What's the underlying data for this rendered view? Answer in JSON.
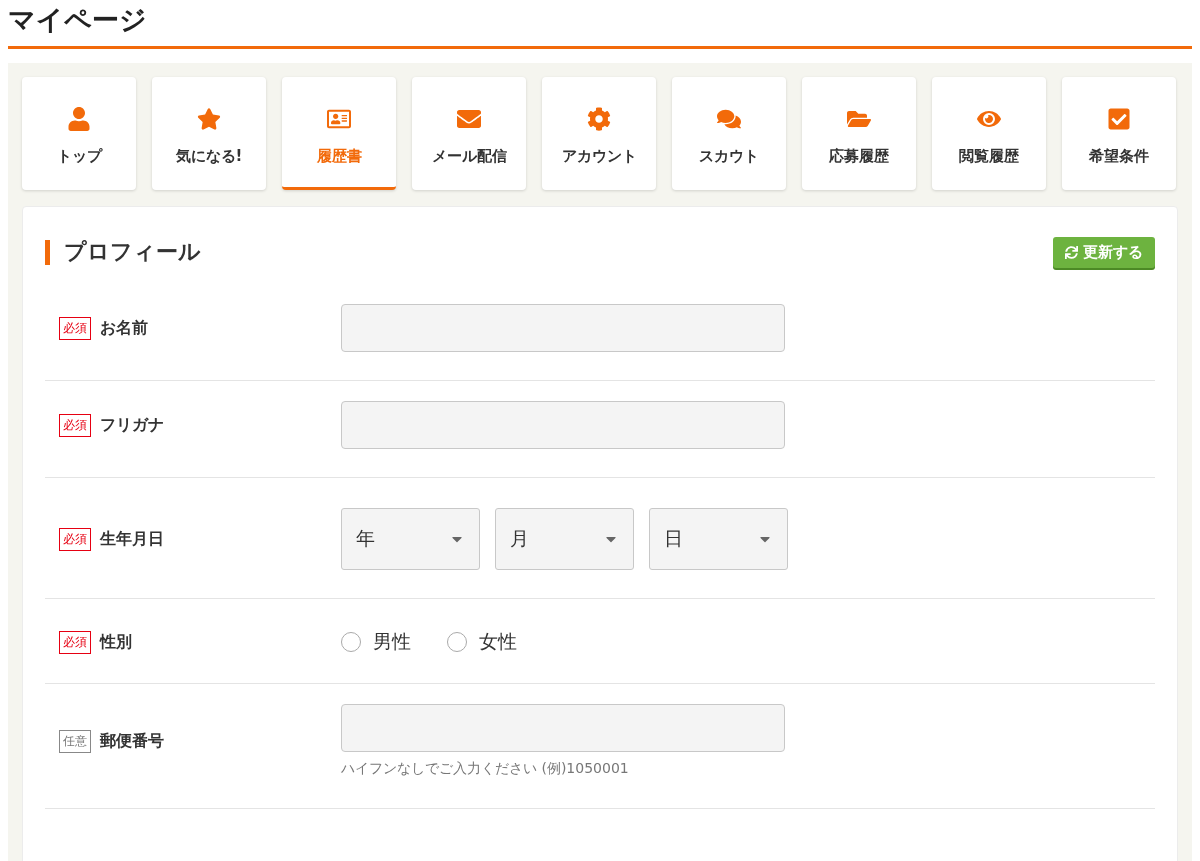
{
  "page_title": "マイページ",
  "tabs": [
    {
      "label": "トップ",
      "selected": false
    },
    {
      "label": "気になる!",
      "selected": false
    },
    {
      "label": "履歴書",
      "selected": true
    },
    {
      "label": "メール配信",
      "selected": false
    },
    {
      "label": "アカウント",
      "selected": false
    },
    {
      "label": "スカウト",
      "selected": false
    },
    {
      "label": "応募履歴",
      "selected": false
    },
    {
      "label": "閲覧履歴",
      "selected": false
    },
    {
      "label": "希望条件",
      "selected": false
    }
  ],
  "section": {
    "title": "プロフィール",
    "update_button": "更新する"
  },
  "fields": [
    {
      "kind": "text",
      "badge": "必須",
      "required": true,
      "label": "お名前"
    },
    {
      "kind": "text",
      "badge": "必須",
      "required": true,
      "label": "フリガナ"
    },
    {
      "kind": "date",
      "badge": "必須",
      "required": true,
      "label": "生年月日",
      "selects": [
        "年",
        "月",
        "日"
      ]
    },
    {
      "kind": "radio",
      "badge": "必須",
      "required": true,
      "label": "性別",
      "options": [
        {
          "label": "男性",
          "selected": false
        },
        {
          "label": "女性",
          "selected": false
        }
      ]
    },
    {
      "kind": "text",
      "badge": "任意",
      "required": false,
      "label": "郵便番号",
      "hint": "ハイフンなしでご入力ください (例)1050001"
    }
  ]
}
